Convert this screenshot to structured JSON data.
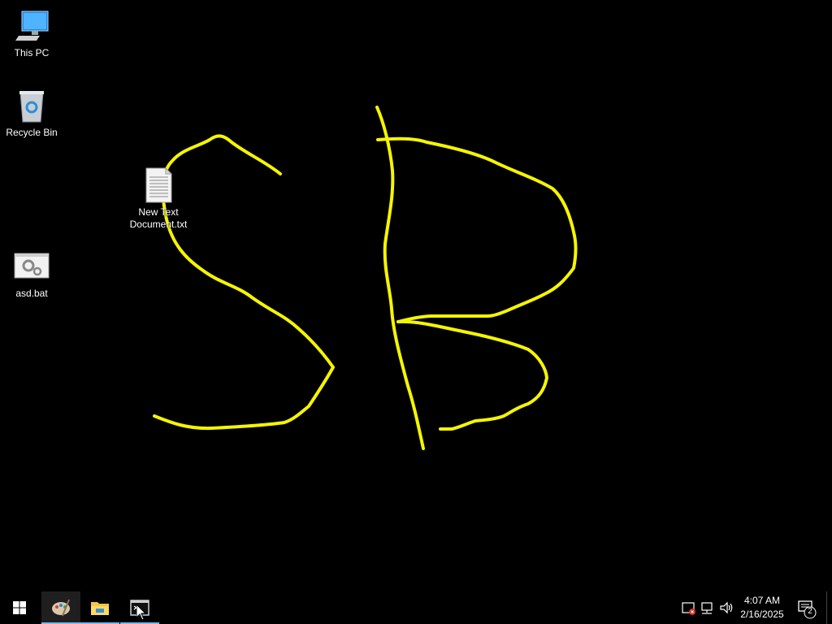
{
  "desktop": {
    "icons": [
      {
        "name": "this-pc",
        "label": "This PC"
      },
      {
        "name": "recycle-bin",
        "label": "Recycle Bin"
      },
      {
        "name": "new-text-document",
        "label": "New Text Document.txt"
      },
      {
        "name": "asd-bat",
        "label": "asd.bat"
      }
    ],
    "drawing": {
      "text": "SB",
      "stroke_color": "#f5f500"
    }
  },
  "taskbar": {
    "start_icon": "windows-logo-icon",
    "apps": [
      {
        "name": "paint",
        "icon": "paint-palette-icon",
        "active": true
      },
      {
        "name": "file-explorer",
        "icon": "folder-icon",
        "active": false
      },
      {
        "name": "command-prompt",
        "icon": "cmd-icon",
        "active": false
      }
    ],
    "tray": {
      "icons": [
        "security-alert-icon",
        "network-icon",
        "volume-icon"
      ],
      "time": "4:07 AM",
      "date": "2/16/2025",
      "notification_count": "2"
    },
    "accent_color": "#76b9ed"
  }
}
